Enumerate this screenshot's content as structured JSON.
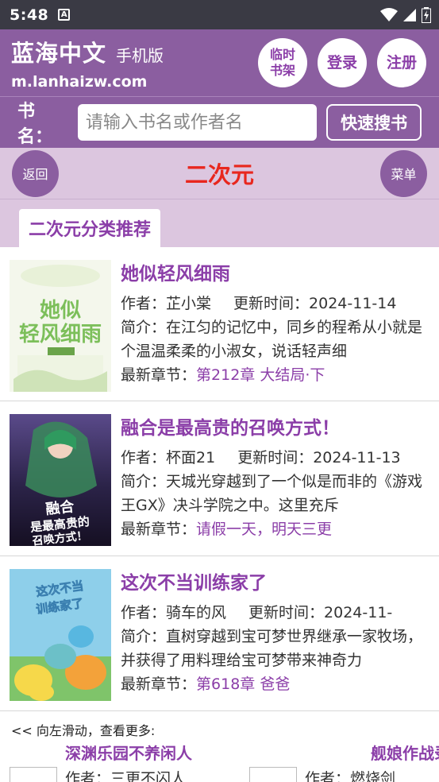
{
  "status": {
    "time": "5:48",
    "notif_icon_text": "A"
  },
  "header": {
    "site_name": "蓝海中文",
    "site_sub": "手机版",
    "domain": "m.lanhaizw.com",
    "bookshelf_label": "临时书架",
    "login_label": "登录",
    "register_label": "注册"
  },
  "search": {
    "label": "书名：",
    "placeholder": "请输入书名或作者名",
    "button": "快速搜书"
  },
  "nav": {
    "back": "返回",
    "title": "二次元",
    "menu": "菜单"
  },
  "section": {
    "tab": "二次元分类推荐"
  },
  "books": [
    {
      "title": "她似轻风细雨",
      "author_label": "作者：",
      "author": "芷小棠",
      "update_label": "更新时间：",
      "update": "2024-11-14",
      "intro_label": "简介：",
      "intro": "在江匀的记忆中，同乡的程希从小就是个温温柔柔的小淑女，说话轻声细",
      "latest_label": "最新章节：",
      "latest": "第212章 大结局·下",
      "cover_text": "她似轻风细雨"
    },
    {
      "title": "融合是最高贵的召唤方式！",
      "author_label": "作者：",
      "author": "杯面21",
      "update_label": "更新时间：",
      "update": "2024-11-13",
      "intro_label": "简介：",
      "intro": "天城光穿越到了一个似是而非的《游戏王GX》决斗学院之中。这里充斥",
      "latest_label": "最新章节：",
      "latest": "请假一天，明天三更",
      "cover_text": "融合是最高贵的召唤方式！"
    },
    {
      "title": "这次不当训练家了",
      "author_label": "作者：",
      "author": "骑车的风",
      "update_label": "更新时间：",
      "update": "2024-11-",
      "intro_label": "简介：",
      "intro": "直树穿越到宝可梦世界继承一家牧场，并获得了用料理给宝可梦带来神奇力",
      "latest_label": "最新章节：",
      "latest": "第618章 爸爸",
      "cover_text": "这次不当训练家了"
    }
  ],
  "more": {
    "hint": "<< 向左滑动，查看更多:",
    "items": [
      {
        "title": "深渊乐园不养闲人",
        "author_partial": "作者：三更不闪人"
      },
      {
        "title": "舰娘作战录",
        "author_partial": "作者：燃烧剑"
      }
    ]
  },
  "colors": {
    "brand": "#8b5ea0",
    "accent_red": "#e8271e",
    "link": "#8b3ea8",
    "tint": "#dcc6df"
  }
}
